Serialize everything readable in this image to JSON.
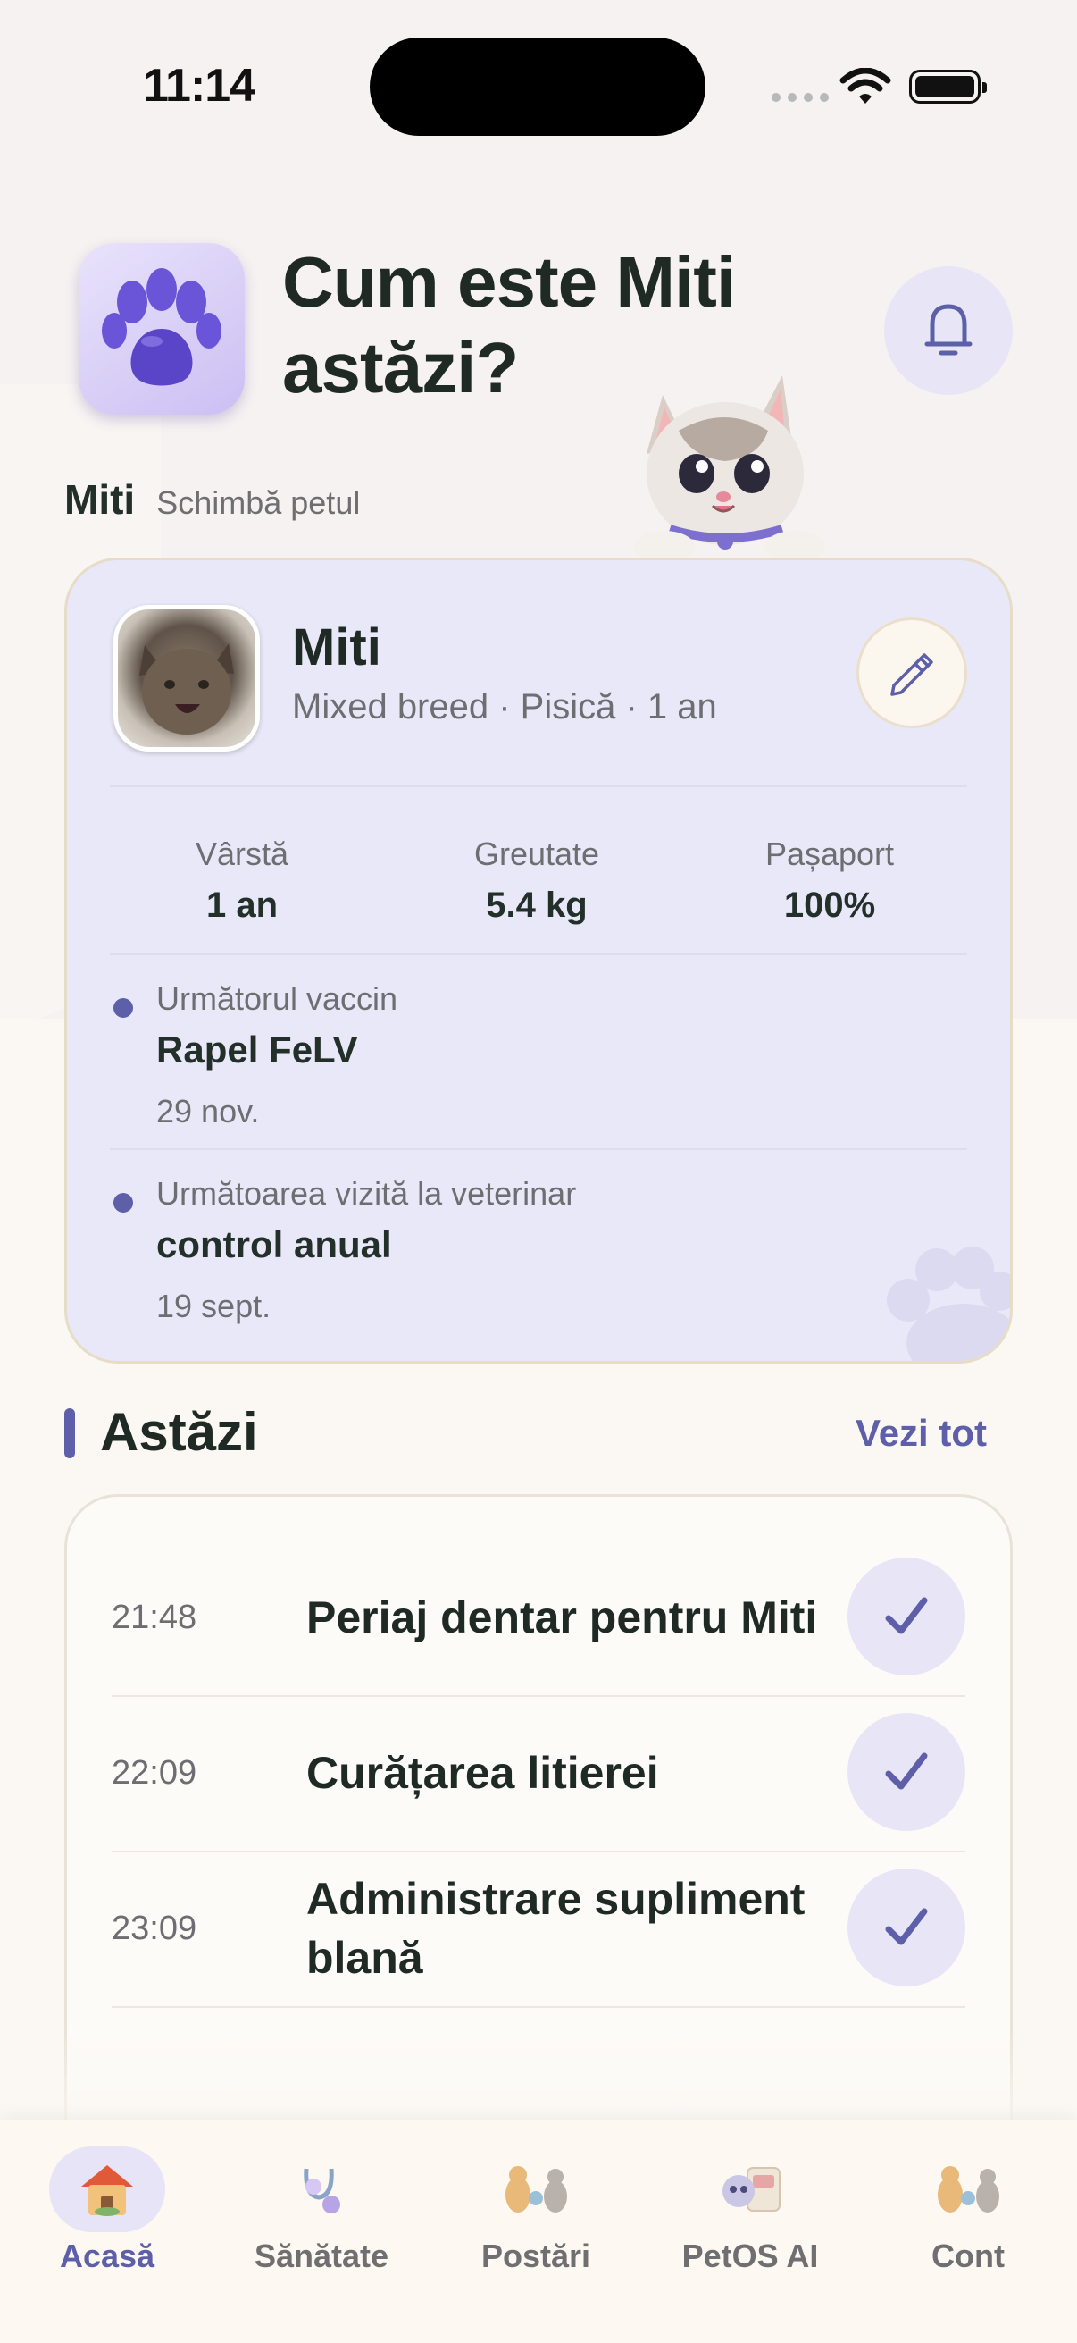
{
  "status_bar": {
    "time": "11:14"
  },
  "header": {
    "title": "Cum este Miti astăzi?",
    "pet_name": "Miti",
    "change_pet": "Schimbă petul"
  },
  "pet_card": {
    "name": "Miti",
    "subtitle": "Mixed breed · Pisică · 1 an",
    "stats": [
      {
        "label": "Vârstă",
        "value": "1 an"
      },
      {
        "label": "Greutate",
        "value": "5.4 kg"
      },
      {
        "label": "Pașaport",
        "value": "100%"
      }
    ],
    "next_vaccine": {
      "label": "Următorul vaccin",
      "title": "Rapel FeLV",
      "date": "29 nov."
    },
    "next_vet_visit": {
      "label": "Următoarea vizită la veterinar",
      "title": "control anual",
      "date": "19 sept."
    }
  },
  "today": {
    "title": "Astăzi",
    "see_all": "Vezi tot",
    "tasks": [
      {
        "time": "21:48",
        "title": "Periaj dentar pentru Miti"
      },
      {
        "time": "22:09",
        "title": "Curățarea litierei"
      },
      {
        "time": "23:09",
        "title": "Administrare supliment blană"
      }
    ]
  },
  "bottom_nav": {
    "items": [
      {
        "label": "Acasă",
        "icon": "house-icon",
        "active": true
      },
      {
        "label": "Sănătate",
        "icon": "stethoscope-icon",
        "active": false
      },
      {
        "label": "Postări",
        "icon": "pets-icon",
        "active": false
      },
      {
        "label": "PetOS AI",
        "icon": "ai-robot-icon",
        "active": false
      },
      {
        "label": "Cont",
        "icon": "account-pets-icon",
        "active": false
      }
    ]
  },
  "colors": {
    "accent": "#5d5fa8",
    "card_bg": "#e9e8f8",
    "text_dark": "#1f2a24"
  }
}
